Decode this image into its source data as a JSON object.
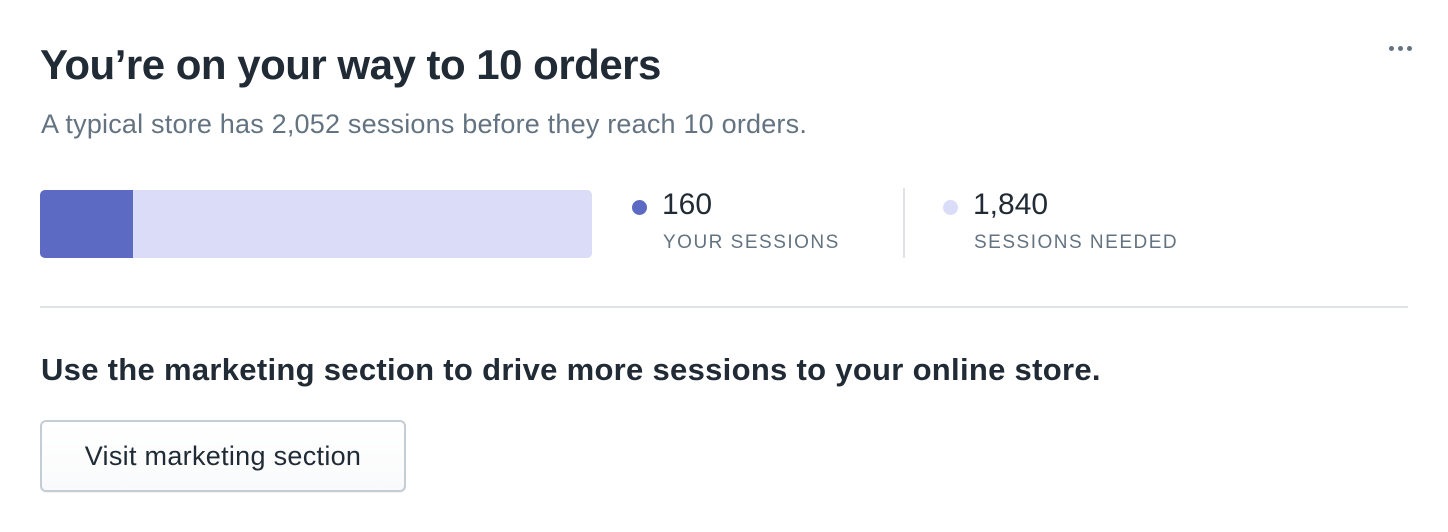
{
  "card": {
    "title": "You’re on your way to 10 orders",
    "subtitle": "A typical store has 2,052 sessions before they reach 10 orders.",
    "more_actions_icon": "horizontal-dots-icon"
  },
  "progress": {
    "current": 160,
    "goal": 2052,
    "fraction": 0.168,
    "fill_color": "#5c6ac4",
    "track_color": "#dadcf8"
  },
  "stats": {
    "yours": {
      "value": "160",
      "label": "YOUR SESSIONS",
      "dot_color": "#5c6ac4"
    },
    "needed": {
      "value": "1,840",
      "label": "SESSIONS NEEDED",
      "dot_color": "#dadcf8"
    }
  },
  "cta": {
    "text": "Use the marketing section to drive more sessions to your online store.",
    "button_label": "Visit marketing section"
  }
}
